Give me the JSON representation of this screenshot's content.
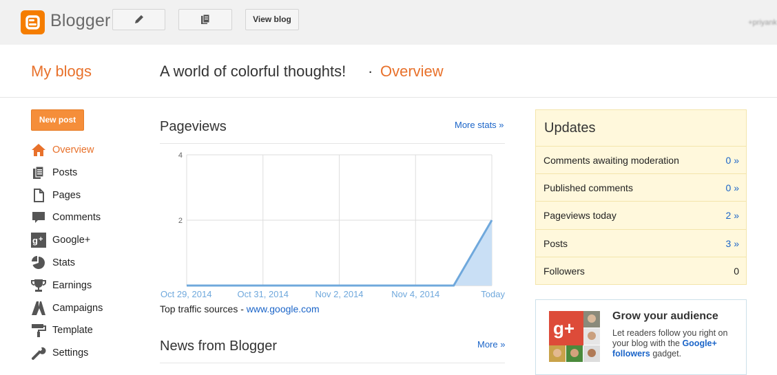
{
  "app": {
    "name": "Blogger",
    "user": "+priyank"
  },
  "toolbar": {
    "view_blog": "View blog"
  },
  "header": {
    "my_blogs": "My blogs",
    "blog_title": "A world of colorful thoughts!",
    "separator": "·",
    "current": "Overview"
  },
  "sidebar": {
    "new_post": "New post",
    "items": [
      {
        "label": "Overview",
        "icon": "home-icon",
        "active": true
      },
      {
        "label": "Posts",
        "icon": "posts-icon"
      },
      {
        "label": "Pages",
        "icon": "page-icon"
      },
      {
        "label": "Comments",
        "icon": "comment-icon"
      },
      {
        "label": "Google+",
        "icon": "google-plus-icon"
      },
      {
        "label": "Stats",
        "icon": "pie-chart-icon"
      },
      {
        "label": "Earnings",
        "icon": "trophy-icon"
      },
      {
        "label": "Campaigns",
        "icon": "campaign-icon"
      },
      {
        "label": "Template",
        "icon": "paint-roller-icon"
      },
      {
        "label": "Settings",
        "icon": "wrench-icon"
      }
    ]
  },
  "pageviews": {
    "title": "Pageviews",
    "more": "More stats »",
    "traffic_label": "Top traffic sources -",
    "traffic_link": "www.google.com"
  },
  "chart_data": {
    "type": "area",
    "categories": [
      "Oct 29, 2014",
      "Oct 31, 2014",
      "Nov 2, 2014",
      "Nov 4, 2014",
      "Today"
    ],
    "x_points": [
      "Oct 29",
      "Oct 30",
      "Oct 31",
      "Nov 1",
      "Nov 2",
      "Nov 3",
      "Nov 4",
      "Nov 5",
      "Today"
    ],
    "values": [
      0,
      0,
      0,
      0,
      0,
      0,
      0,
      0,
      2
    ],
    "yticks": [
      2,
      4
    ],
    "ylim": [
      0,
      4
    ],
    "color": "#6fa8dc"
  },
  "news": {
    "title": "News from Blogger",
    "more": "More »"
  },
  "updates": {
    "title": "Updates",
    "rows": [
      {
        "label": "Comments awaiting moderation",
        "value": "0 »",
        "link": true
      },
      {
        "label": "Published comments",
        "value": "0 »",
        "link": true
      },
      {
        "label": "Pageviews today",
        "value": "2 »",
        "link": true
      },
      {
        "label": "Posts",
        "value": "3 »",
        "link": true
      },
      {
        "label": "Followers",
        "value": "0",
        "link": false
      }
    ]
  },
  "grow": {
    "title": "Grow your audience",
    "text_1": "Let readers follow you right on your blog with the ",
    "text_link": "Google+ followers",
    "text_2": " gadget."
  },
  "colors": {
    "accent": "#e8712b",
    "link": "#1a64c8",
    "updates_bg": "#fff8dc"
  }
}
